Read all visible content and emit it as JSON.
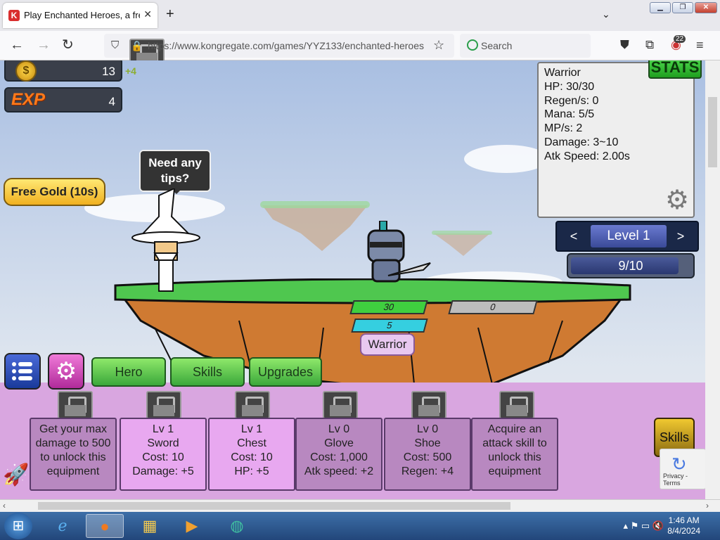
{
  "browser": {
    "tab_title": "Play Enchanted Heroes, a free o",
    "tab_favicon": "K",
    "new_tab": "+",
    "url": "https://www.kongregate.com/games/YYZ133/enchanted-heroes",
    "search_placeholder": "Search",
    "extension_badge": "22"
  },
  "game": {
    "gold_value": "13",
    "gold_gain": "+4",
    "exp_label": "EXP",
    "exp_value": "4",
    "free_gold": "Free Gold (10s)",
    "speech": "Need any tips?",
    "stats_button": "STATS",
    "stats": {
      "name": "Warrior",
      "hp": "HP: 30/30",
      "regen": "Regen/s: 0",
      "mana": "Mana: 5/5",
      "mps": "MP/s: 2",
      "damage": "Damage: 3~10",
      "atk_speed": "Atk Speed: 2.00s"
    },
    "level": {
      "prev": "<",
      "label": "Level 1",
      "next": ">"
    },
    "wave_progress": {
      "text": "9/10",
      "fraction": 0.9
    },
    "hero_hp": "30",
    "hero_mp": "5",
    "enemy_hp": "0",
    "hero_name": "Warrior",
    "tabs": {
      "hero": "Hero",
      "skills": "Skills",
      "upgrades": "Upgrades"
    },
    "cards": [
      {
        "lines": [
          "Get your max",
          "damage to 500",
          "to unlock this",
          "equipment"
        ],
        "locked": true
      },
      {
        "lines": [
          "Lv 1",
          "Sword",
          "Cost: 10",
          "Damage: +5"
        ],
        "locked": false
      },
      {
        "lines": [
          "Lv 1",
          "Chest",
          "Cost: 10",
          "HP: +5"
        ],
        "locked": false
      },
      {
        "lines": [
          "Lv 0",
          "Glove",
          "Cost: 1,000",
          "Atk speed: +2"
        ],
        "locked": false
      },
      {
        "lines": [
          "Lv 0",
          "Shoe",
          "Cost: 500",
          "Regen: +4"
        ],
        "locked": false
      },
      {
        "lines": [
          "Acquire an",
          "attack skill to",
          "unlock this",
          "equipment"
        ],
        "locked": true
      }
    ],
    "skills_button": "Skills",
    "recaptcha_footer": "Privacy - Terms"
  },
  "taskbar": {
    "time": "1:46 AM",
    "date": "8/4/2024"
  },
  "colors": {
    "green": "#3ba83b",
    "card_active": "#e8a8f0",
    "card_dim": "#b888c0",
    "shop_bg": "#d9a6e0"
  }
}
